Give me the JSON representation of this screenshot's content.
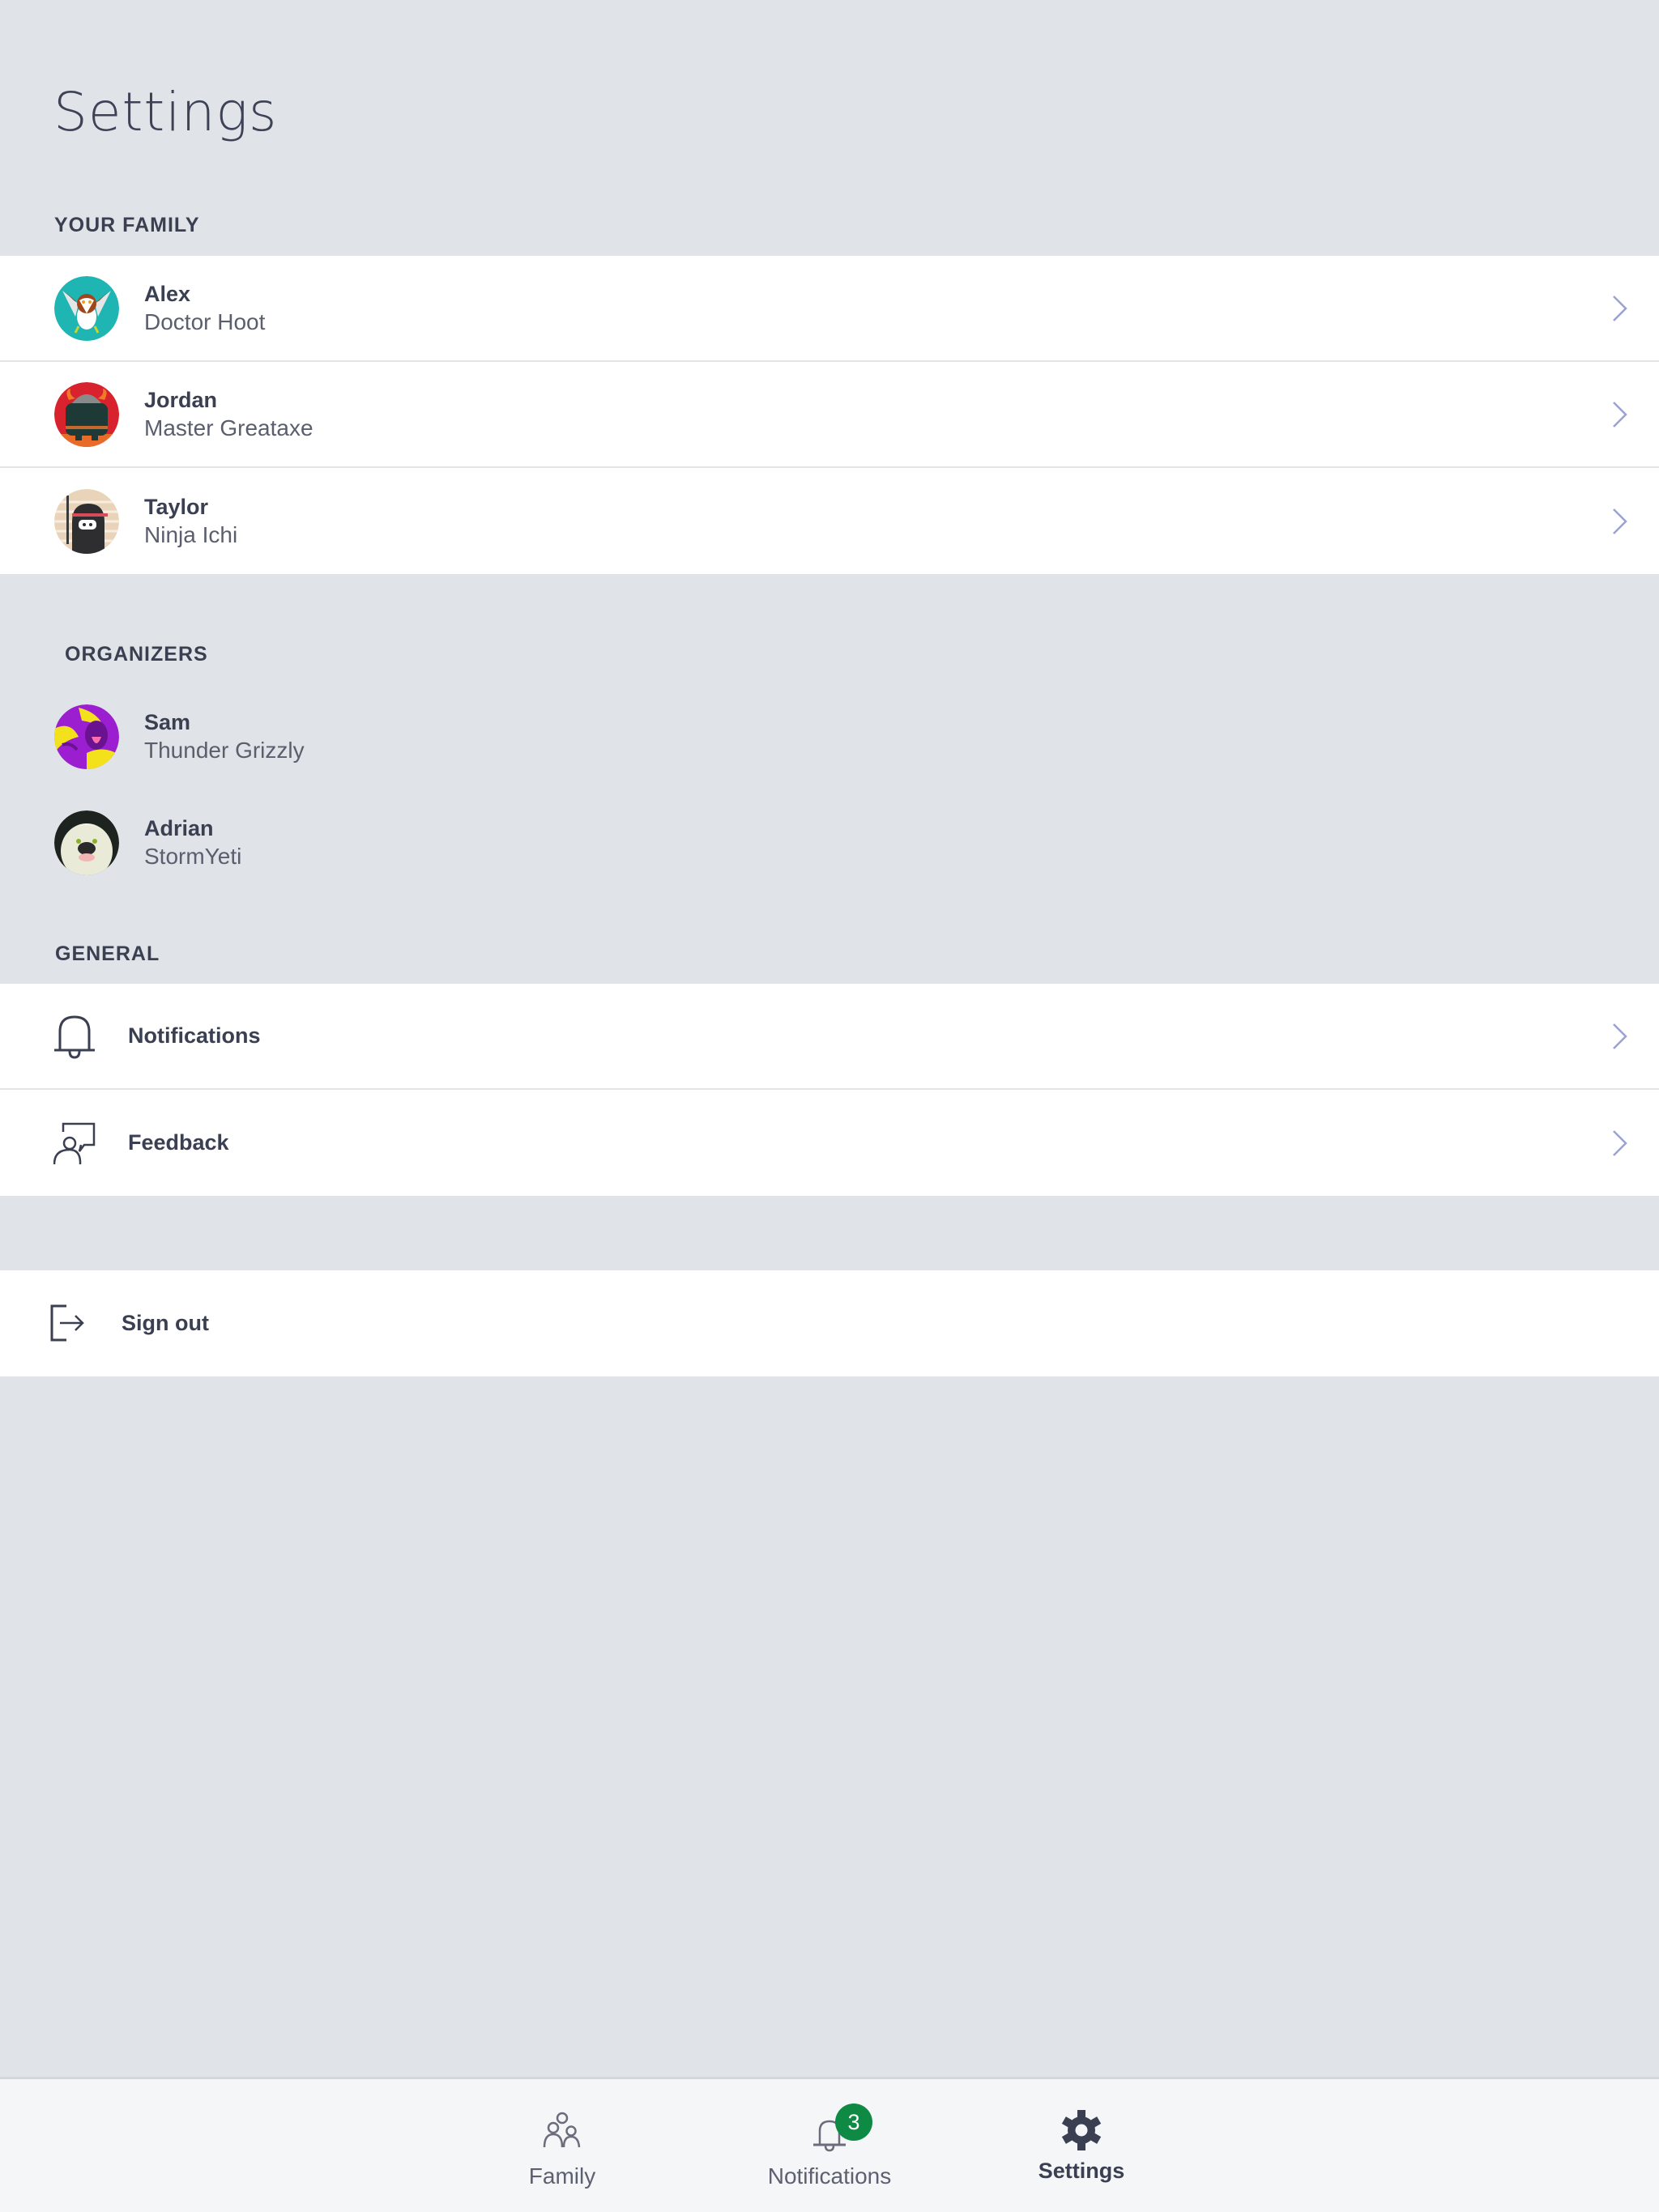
{
  "header": {
    "title": "Settings"
  },
  "sections": {
    "family": {
      "label": "YOUR FAMILY",
      "members": [
        {
          "name": "Alex",
          "gamertag": "Doctor Hoot",
          "avatar": "owl-avatar"
        },
        {
          "name": "Jordan",
          "gamertag": "Master Greataxe",
          "avatar": "viking-beast-avatar"
        },
        {
          "name": "Taylor",
          "gamertag": "Ninja Ichi",
          "avatar": "ninja-avatar"
        }
      ]
    },
    "organizers": {
      "label": "ORGANIZERS",
      "members": [
        {
          "name": "Sam",
          "gamertag": "Thunder Grizzly",
          "avatar": "grizzly-avatar"
        },
        {
          "name": "Adrian",
          "gamertag": "StormYeti",
          "avatar": "yeti-avatar"
        }
      ]
    },
    "general": {
      "label": "GENERAL",
      "items": [
        {
          "label": "Notifications",
          "icon": "bell-icon"
        },
        {
          "label": "Feedback",
          "icon": "feedback-icon"
        }
      ]
    },
    "account": {
      "sign_out_label": "Sign out",
      "icon": "sign-out-icon"
    }
  },
  "bottom_nav": {
    "tabs": [
      {
        "label": "Family",
        "icon": "family-icon",
        "active": false
      },
      {
        "label": "Notifications",
        "icon": "bell-icon",
        "active": false,
        "badge": "3"
      },
      {
        "label": "Settings",
        "icon": "gear-icon",
        "active": true
      }
    ]
  },
  "colors": {
    "background": "#e0e3e7",
    "card": "#ffffff",
    "text": "#3a3f51",
    "chevron": "#9aa3d1",
    "badge": "#0e8a44",
    "bottom_bar": "#f4f6f8"
  }
}
